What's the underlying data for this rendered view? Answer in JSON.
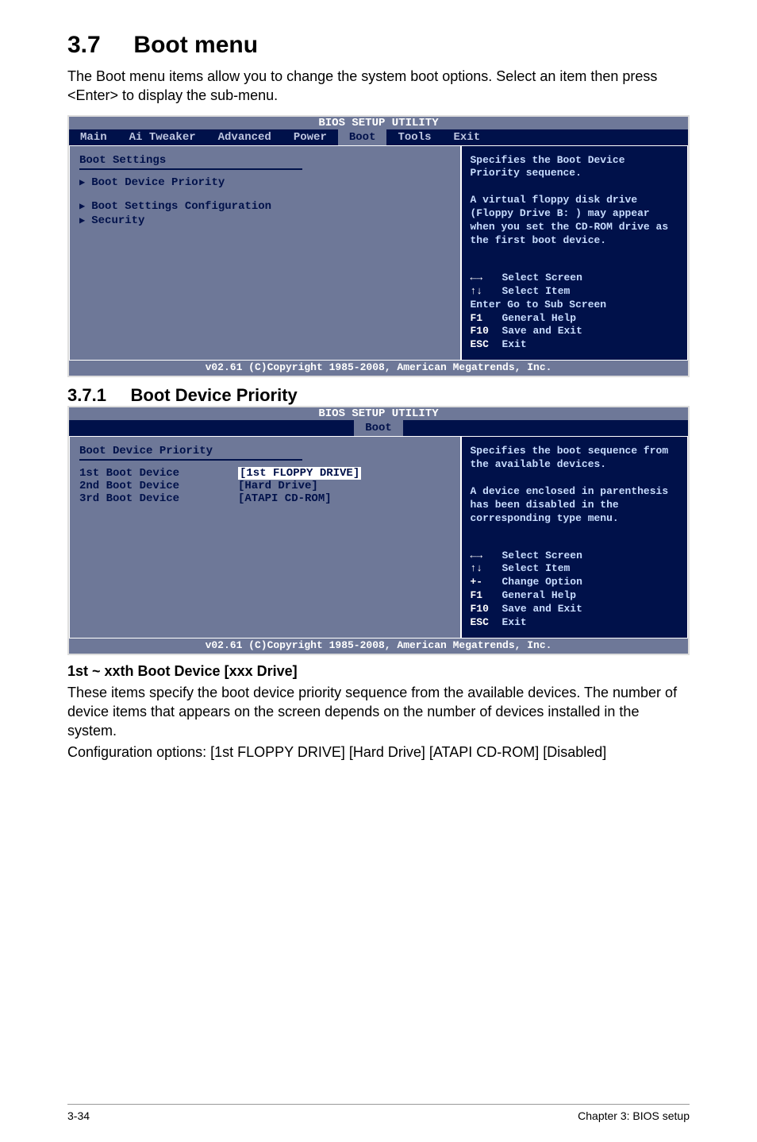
{
  "page": {
    "section_number": "3.7",
    "section_title": "Boot menu",
    "intro": "The Boot menu items allow you to change the system boot options. Select an item then press <Enter> to display the sub-menu."
  },
  "bios1": {
    "title": "BIOS SETUP UTILITY",
    "tabs": [
      "Main",
      "Ai Tweaker",
      "Advanced",
      "Power",
      "Boot",
      "Tools",
      "Exit"
    ],
    "heading": "Boot Settings",
    "items": [
      "Boot Device Priority",
      "Boot Settings Configuration",
      "Security"
    ],
    "help": "Specifies the Boot Device Priority sequence.\n\nA virtual floppy disk drive (Floppy Drive B: ) may appear when you set the CD-ROM drive as the first boot device.",
    "nav": {
      "select_screen": "Select Screen",
      "select_item": "Select Item",
      "enter": "Enter Go to Sub Screen",
      "f1": "General Help",
      "f10": "Save and Exit",
      "esc": "Exit"
    },
    "copyright": "v02.61 (C)Copyright 1985-2008, American Megatrends, Inc."
  },
  "subsection": {
    "number": "3.7.1",
    "title": "Boot Device Priority"
  },
  "bios2": {
    "title": "BIOS SETUP UTILITY",
    "tab": "Boot",
    "heading": "Boot Device Priority",
    "fields": [
      {
        "label": "1st Boot Device",
        "value": "[1st FLOPPY DRIVE]"
      },
      {
        "label": "2nd Boot Device",
        "value": "[Hard Drive]"
      },
      {
        "label": "3rd Boot Device",
        "value": "[ATAPI CD-ROM]"
      }
    ],
    "help": "Specifies the boot sequence from the available devices.\n\nA device enclosed in parenthesis has been disabled in the corresponding type menu.",
    "nav": {
      "select_screen": "Select Screen",
      "select_item": "Select Item",
      "change_option": "Change Option",
      "f1": "General Help",
      "f10": "Save and Exit",
      "esc": "Exit"
    },
    "copyright": "v02.61 (C)Copyright 1985-2008, American Megatrends, Inc."
  },
  "subsub": {
    "title": "1st ~ xxth Boot Device [xxx Drive]",
    "p1": "These items specify the boot device priority sequence from the available devices. The number of device items that appears on the screen depends on the number of devices installed in the system.",
    "p2": "Configuration options: [1st FLOPPY DRIVE] [Hard Drive] [ATAPI CD-ROM] [Disabled]"
  },
  "footer": {
    "left": "3-34",
    "right": "Chapter 3: BIOS setup"
  }
}
